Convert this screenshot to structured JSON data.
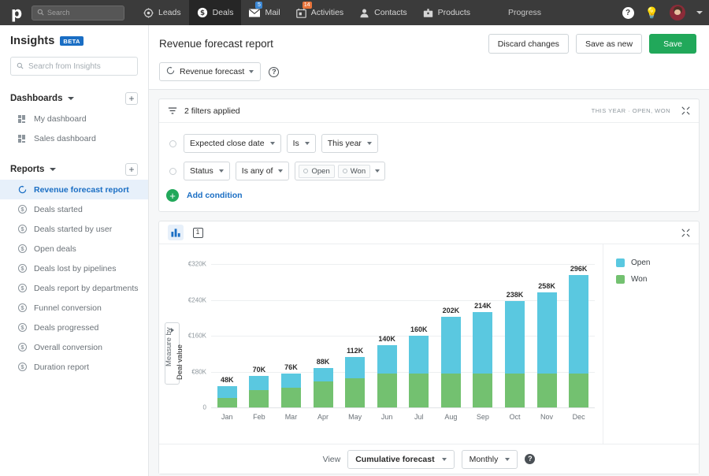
{
  "topnav": {
    "logo": "p",
    "search_placeholder": "Search",
    "search_icon": "search-icon",
    "items": [
      {
        "label": "Leads",
        "icon": "target-icon",
        "active": false,
        "badge": ""
      },
      {
        "label": "Deals",
        "icon": "dollar-circle-icon",
        "active": true,
        "badge": ""
      },
      {
        "label": "Mail",
        "icon": "envelope-icon",
        "active": false,
        "badge": "5"
      },
      {
        "label": "Activities",
        "icon": "calendar-icon",
        "active": false,
        "badge": "14"
      },
      {
        "label": "Contacts",
        "icon": "person-icon",
        "active": false,
        "badge": ""
      },
      {
        "label": "Products",
        "icon": "box-icon",
        "active": false,
        "badge": ""
      }
    ],
    "progress_label": "Progress",
    "help_icon": "question-circle-icon",
    "tips_icon": "lightbulb-icon",
    "avatar": "user-avatar",
    "avatar_caret": "chevron-down-icon"
  },
  "sidebar": {
    "title": "Insights",
    "beta_badge": "BETA",
    "search_placeholder": "Search from Insights",
    "sections": [
      {
        "title": "Dashboards",
        "add_label": "+",
        "items": [
          {
            "label": "My dashboard",
            "icon": "dashboard-icon",
            "active": false
          },
          {
            "label": "Sales dashboard",
            "icon": "dashboard-icon",
            "active": false
          }
        ]
      },
      {
        "title": "Reports",
        "add_label": "+",
        "items": [
          {
            "label": "Revenue forecast report",
            "icon": "forecast-icon",
            "active": true
          },
          {
            "label": "Deals started",
            "icon": "deal-icon",
            "active": false
          },
          {
            "label": "Deals started by user",
            "icon": "deal-icon",
            "active": false
          },
          {
            "label": "Open deals",
            "icon": "deal-icon",
            "active": false
          },
          {
            "label": "Deals lost by pipelines",
            "icon": "deal-icon",
            "active": false
          },
          {
            "label": "Deals report by departments",
            "icon": "deal-icon",
            "active": false
          },
          {
            "label": "Funnel conversion",
            "icon": "deal-icon",
            "active": false
          },
          {
            "label": "Deals progressed",
            "icon": "deal-icon",
            "active": false
          },
          {
            "label": "Overall conversion",
            "icon": "deal-icon",
            "active": false
          },
          {
            "label": "Duration report",
            "icon": "deal-icon",
            "active": false
          }
        ]
      }
    ]
  },
  "header": {
    "page_title": "Revenue forecast report",
    "discard_label": "Discard changes",
    "save_as_new_label": "Save as new",
    "save_label": "Save",
    "report_type": "Revenue forecast",
    "report_type_icon": "forecast-icon",
    "help_icon": "question-mark-icon"
  },
  "filters": {
    "icon": "filter-icon",
    "summary": "2 filters applied",
    "meta": "THIS YEAR · OPEN, WON",
    "collapse_icon": "collapse-icon",
    "conditions": [
      {
        "field": "Expected close date",
        "operator": "Is",
        "value": "This year",
        "values": []
      },
      {
        "field": "Status",
        "operator": "Is any of",
        "value": "",
        "values": [
          "Open",
          "Won"
        ]
      }
    ],
    "add_condition_label": "Add condition",
    "add_condition_icon": "plus-circle-icon"
  },
  "chart_panel": {
    "chart_view_icon": "bar-chart-icon",
    "table_view_icon": "single-number-icon",
    "table_view_label": "1",
    "collapse_icon": "collapse-icon",
    "measure_by_label": "Measure by",
    "measure_value": "Deal value",
    "view_label": "View",
    "view_value": "Cumulative forecast",
    "interval_value": "Monthly",
    "footer_help_icon": "question-circle-icon"
  },
  "chart_data": {
    "type": "bar",
    "stacked": true,
    "title": "",
    "xlabel": "",
    "ylabel": "Deal value",
    "categories": [
      "Jan",
      "Feb",
      "Mar",
      "Apr",
      "May",
      "Jun",
      "Jul",
      "Aug",
      "Sep",
      "Oct",
      "Nov",
      "Dec"
    ],
    "totals": [
      48,
      70,
      76,
      88,
      112,
      140,
      160,
      202,
      214,
      238,
      258,
      296
    ],
    "total_labels": [
      "48K",
      "70K",
      "76K",
      "88K",
      "112K",
      "140K",
      "160K",
      "202K",
      "214K",
      "238K",
      "258K",
      "296K"
    ],
    "series": [
      {
        "name": "Won",
        "color": "#73c170",
        "values": [
          22,
          38,
          44,
          58,
          66,
          76,
          76,
          76,
          76,
          76,
          76,
          76
        ]
      },
      {
        "name": "Open",
        "color": "#5ac8e0",
        "values": [
          26,
          32,
          32,
          30,
          46,
          64,
          84,
          126,
          138,
          162,
          182,
          220
        ]
      }
    ],
    "ylim": [
      0,
      340
    ],
    "yticks": [
      0,
      80,
      160,
      240,
      320
    ],
    "ytick_labels": [
      "0",
      "€80K",
      "€160K",
      "€240K",
      "€320K"
    ],
    "legend": [
      {
        "label": "Open",
        "color": "#5ac8e0"
      },
      {
        "label": "Won",
        "color": "#73c170"
      }
    ],
    "legend_position": "right",
    "grid": true,
    "units": "EUR thousands"
  }
}
